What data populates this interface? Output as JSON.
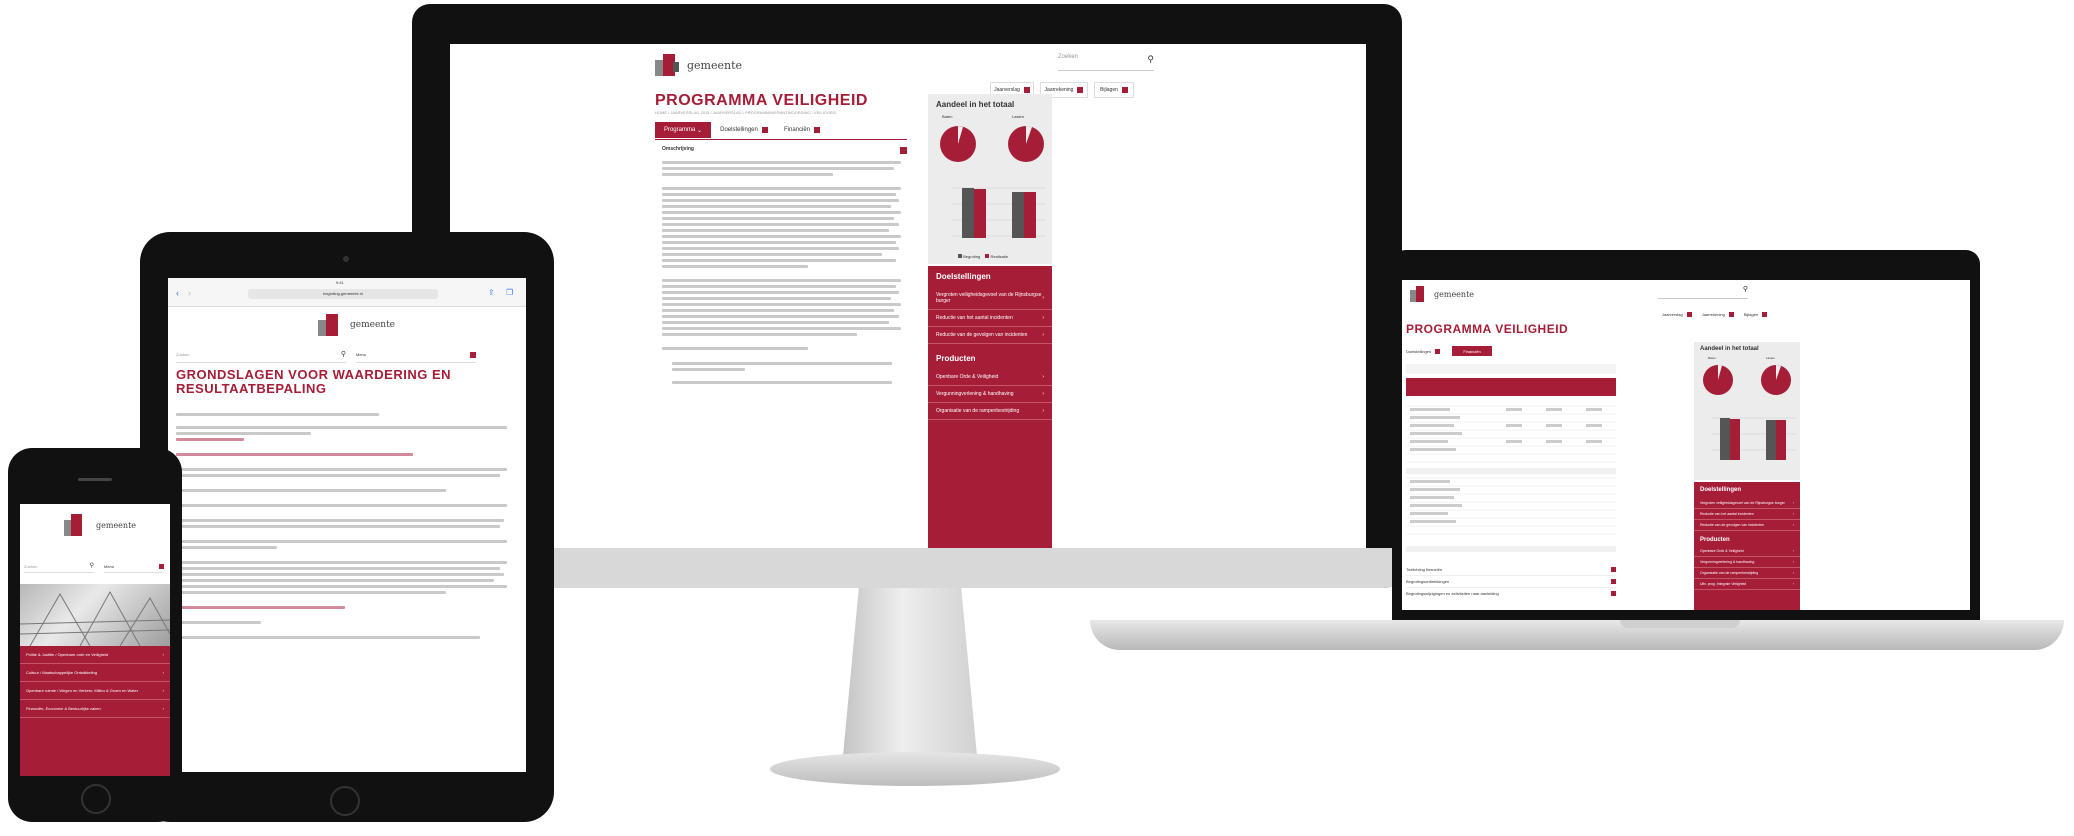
{
  "brand": {
    "logo_text": "gemeente",
    "accent": "#a51d36"
  },
  "desktop": {
    "search_placeholder": "Zoeken",
    "top_links": [
      {
        "label": "Jaarverslag"
      },
      {
        "label": "Jaarrekening"
      },
      {
        "label": "Bijlagen"
      }
    ],
    "page_title": "PROGRAMMA VEILIGHEID",
    "breadcrumb": "HOME / JAARVERSLAG 2015 / JAARVERSLAG / PROGRAMMAVERANTWOORDING / VEILIGHEID",
    "tabs": [
      {
        "label": "Programma"
      },
      {
        "label": "Doelstellingen"
      },
      {
        "label": "Financiën"
      }
    ],
    "section_header": "Omschrijving",
    "sidebar_title": "Aandeel in het totaal",
    "pie_labels": [
      "Baten",
      "Lasten"
    ],
    "goals_title": "Doelstellingen",
    "goals": [
      {
        "label": "Vergroten veiligheidsgevoel van de Rijnsburgse burger"
      },
      {
        "label": "Reductie van het aantal incidenten"
      },
      {
        "label": "Reductie van de gevolgen van incidenten"
      }
    ],
    "products_title": "Producten",
    "products": [
      {
        "label": "Openbare Orde & Veiligheid"
      },
      {
        "label": "Vergunningverlening & handhaving"
      },
      {
        "label": "Organisatie van de rampenbestrijding"
      }
    ],
    "chart_legend": [
      "Begroting",
      "Realisatie"
    ]
  },
  "laptop": {
    "page_title": "PROGRAMMA VEILIGHEID",
    "top_links": [
      {
        "label": "Jaarverslag"
      },
      {
        "label": "Jaarrekening"
      },
      {
        "label": "Bijlagen"
      }
    ],
    "tabs": [
      {
        "label": "Doelstellingen"
      },
      {
        "label": "Financiën"
      }
    ],
    "sidebar_title": "Aandeel in het totaal",
    "pie_labels": [
      "Baten",
      "Lasten"
    ],
    "goals_title": "Doelstellingen",
    "goals": [
      {
        "label": "Vergroten veiligheidsgevoel van de Rijnsburgse burger"
      },
      {
        "label": "Reductie van het aantal incidenten"
      },
      {
        "label": "Reductie van de gevolgen van incidenten"
      }
    ],
    "products_title": "Producten",
    "products": [
      {
        "label": "Openbare Orde & Veiligheid"
      },
      {
        "label": "Vergunningverlening & handhaving"
      },
      {
        "label": "Organisatie van de rampenbestrijding"
      },
      {
        "label": "Uitv. prog. Integrale Veiligheid"
      }
    ],
    "accordions": [
      {
        "label": "Toelichting financiën"
      },
      {
        "label": "Begrotingsonttrekkingen"
      },
      {
        "label": "Begrotingswijzigingen en activiteiten naar aanleiding"
      }
    ]
  },
  "tablet": {
    "status_time": "9:41",
    "url": "begroting.gemeente.nl",
    "search_placeholder": "Zoeken",
    "menu_label": "Menu",
    "page_title": "GRONDSLAGEN VOOR WAARDERING EN RESULTAATBEPALING"
  },
  "phone": {
    "search_placeholder": "Zoeken",
    "menu_label": "Menu",
    "menu_items": [
      {
        "label": "Politie & Justitie / Openbare orde en Veiligheid"
      },
      {
        "label": "Cultuur / Maatschappelijke Ontwikkeling"
      },
      {
        "label": "Openbare ruimte / Wegen en Verkeer, Milieu & Groen en Water"
      },
      {
        "label": "Financiën, Economie & Bestuurlijke zaken"
      }
    ]
  }
}
